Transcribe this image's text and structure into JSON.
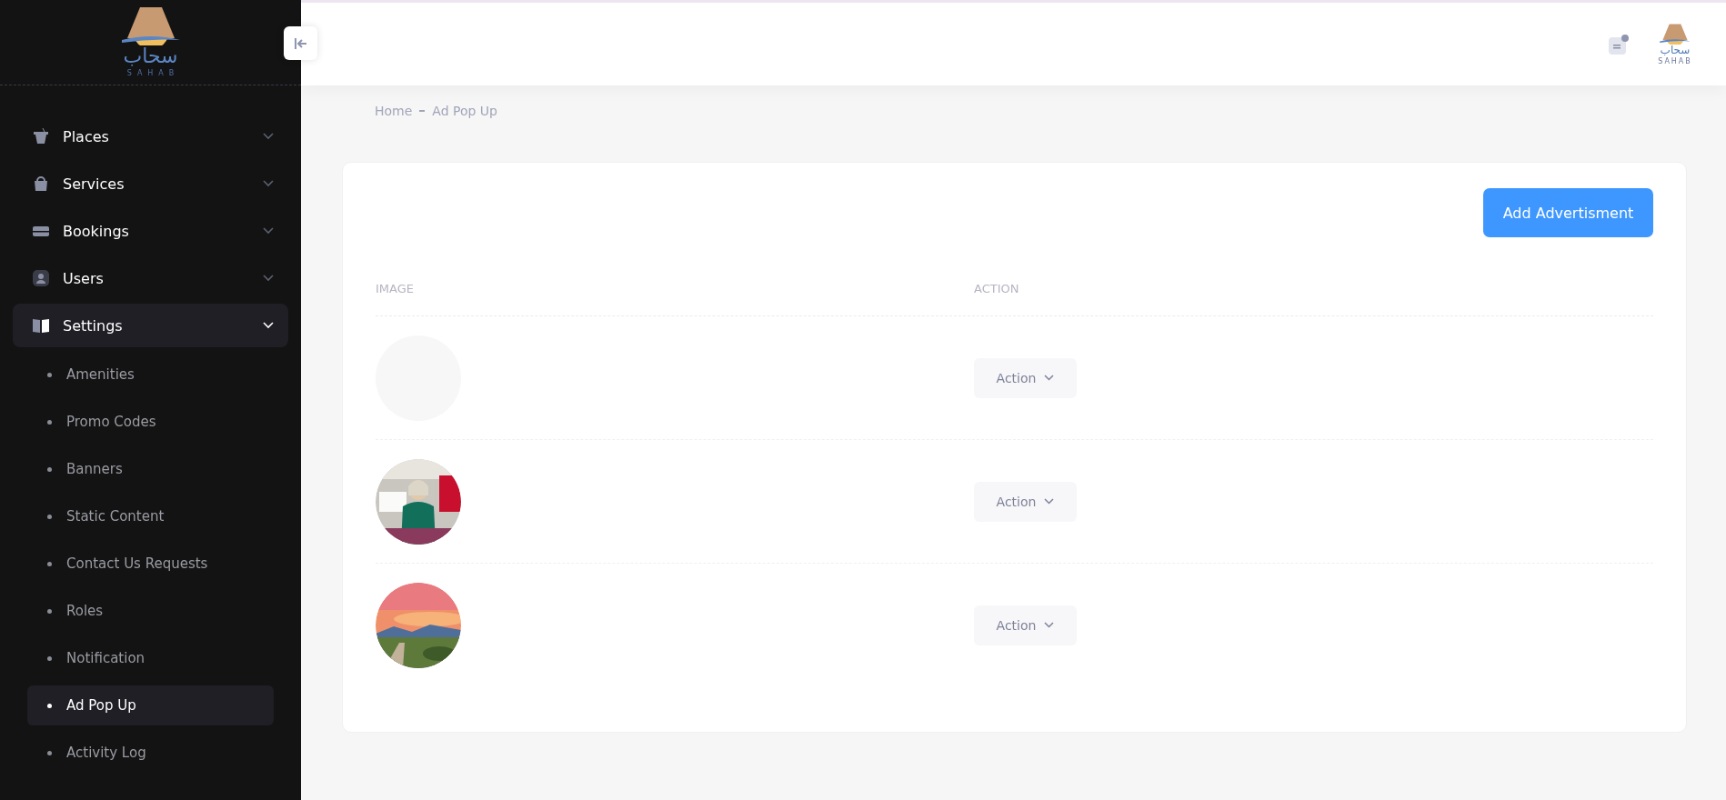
{
  "logo": {
    "arabic": "سحاب",
    "latin": "SAHAB"
  },
  "sidebar": {
    "items": [
      {
        "label": "Places",
        "expanded": false,
        "selected": false
      },
      {
        "label": "Services",
        "expanded": false,
        "selected": false
      },
      {
        "label": "Bookings",
        "expanded": false,
        "selected": false
      },
      {
        "label": "Users",
        "expanded": false,
        "selected": false
      },
      {
        "label": "Settings",
        "expanded": true,
        "selected": true,
        "children": [
          {
            "label": "Amenities",
            "selected": false
          },
          {
            "label": "Promo Codes",
            "selected": false
          },
          {
            "label": "Banners",
            "selected": false
          },
          {
            "label": "Static Content",
            "selected": false
          },
          {
            "label": "Contact Us Requests",
            "selected": false
          },
          {
            "label": "Roles",
            "selected": false
          },
          {
            "label": "Notification",
            "selected": false
          },
          {
            "label": "Ad Pop Up",
            "selected": true
          },
          {
            "label": "Activity Log",
            "selected": false
          }
        ]
      }
    ]
  },
  "header": {
    "notification_dot": true,
    "logo": {
      "arabic": "سحاب",
      "latin": "SAHAB"
    }
  },
  "breadcrumb": [
    "Home",
    "Ad Pop Up"
  ],
  "add_button": "Add Advertisment",
  "table": {
    "columns": [
      "IMAGE",
      "ACTION"
    ],
    "rows": [
      {
        "image": {
          "kind": "empty"
        },
        "action": "Action"
      },
      {
        "action": "Action"
      },
      {
        "action": "Action"
      }
    ]
  }
}
